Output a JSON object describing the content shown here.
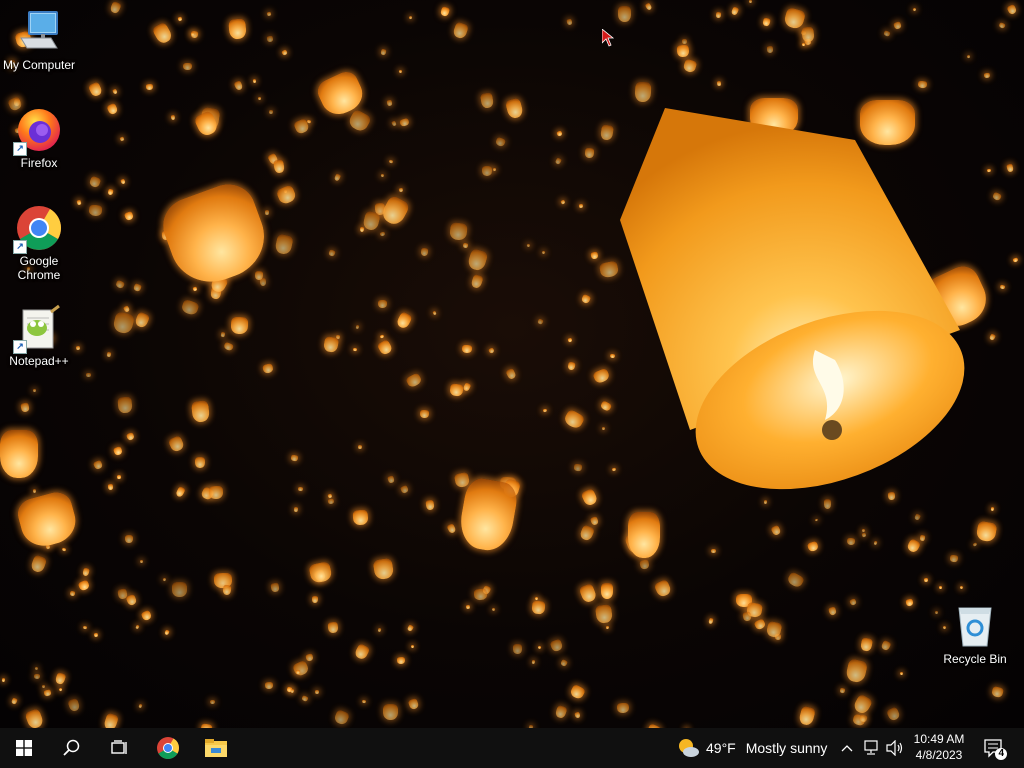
{
  "desktop": {
    "icons": [
      {
        "label": "My Computer",
        "icon": "computer-icon"
      },
      {
        "label": "Firefox",
        "icon": "firefox-icon"
      },
      {
        "label": "Google\nChrome",
        "icon": "chrome-icon"
      },
      {
        "label": "Notepad++",
        "icon": "notepadpp-icon"
      },
      {
        "label": "Recycle Bin",
        "icon": "recycle-bin-icon"
      }
    ]
  },
  "taskbar": {
    "start": {
      "icon": "windows-logo-icon"
    },
    "search": {
      "icon": "search-icon"
    },
    "task_view": {
      "icon": "task-view-icon"
    },
    "pinned": [
      {
        "name": "Google Chrome",
        "icon": "chrome-icon"
      },
      {
        "name": "File Explorer",
        "icon": "folder-icon"
      }
    ],
    "weather": {
      "temp": "49°F",
      "condition": "Mostly sunny",
      "icon": "partly-sunny-icon"
    },
    "tray": {
      "chevron_icon": "chevron-up-icon",
      "network_icon": "network-icon",
      "volume_icon": "speaker-icon"
    },
    "clock": {
      "time": "10:49 AM",
      "date": "4/8/2023"
    },
    "notifications": {
      "count": "4",
      "icon": "notification-icon"
    }
  }
}
